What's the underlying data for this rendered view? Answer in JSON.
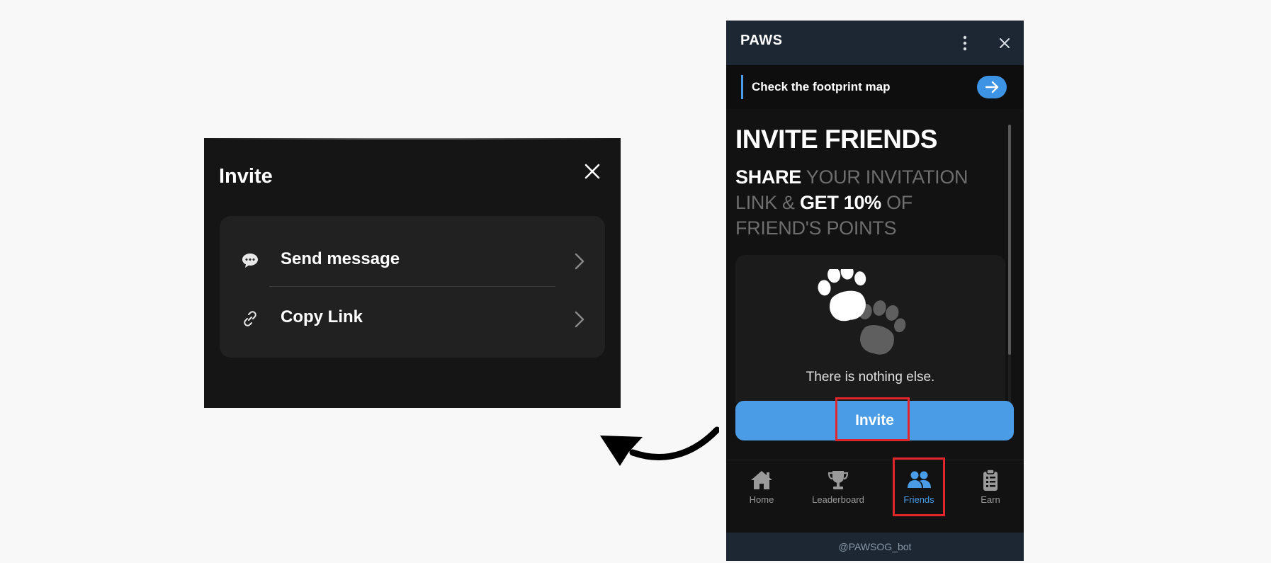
{
  "modal": {
    "title": "Invite",
    "items": [
      {
        "label": "Send message",
        "icon": "chat-bubble-icon"
      },
      {
        "label": "Copy Link",
        "icon": "link-icon"
      }
    ]
  },
  "app": {
    "title": "PAWS",
    "banner_text": "Check the footprint map",
    "heading": "INVITE FRIENDS",
    "sub": {
      "p1": "SHARE",
      "p2": " YOUR INVITATION LINK & ",
      "p3": "GET 10%",
      "p4": " OF FRIEND'S POINTS"
    },
    "empty_text": "There is nothing else.",
    "invite_button": "Invite",
    "tabs": [
      {
        "label": "Home",
        "icon": "home-icon",
        "active": false
      },
      {
        "label": "Leaderboard",
        "icon": "trophy-icon",
        "active": false
      },
      {
        "label": "Friends",
        "icon": "friends-icon",
        "active": true
      },
      {
        "label": "Earn",
        "icon": "clipboard-icon",
        "active": false
      }
    ],
    "footer": "@PAWSOG_bot"
  },
  "colors": {
    "accent": "#4a9ce6",
    "highlight": "#e0262b",
    "header_bg": "#1c2733",
    "modal_bg": "#151515"
  }
}
